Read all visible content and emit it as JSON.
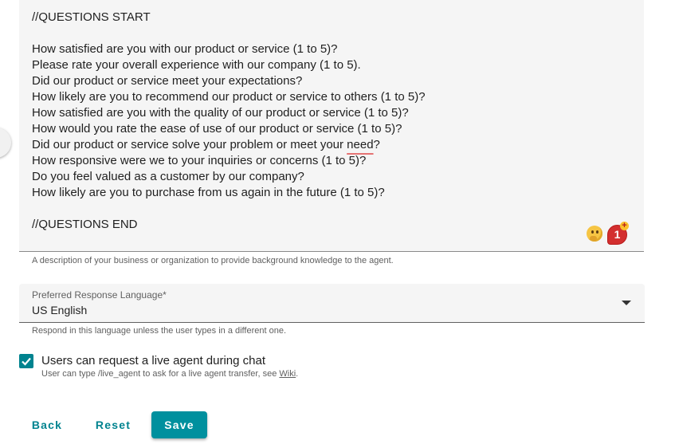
{
  "description_field": {
    "lines": [
      "//QUESTIONS START",
      "",
      "How satisfied are you with our product or service (1 to 5)?",
      "Please rate your overall experience with our company (1 to 5).",
      "Did our product or service meet your expectations?",
      "How likely are you to recommend our product or service to others (1 to 5)?",
      "How satisfied are you with the quality of our product or service (1 to 5)?",
      "How would you rate the ease of use of our product or service (1 to 5)?",
      "Did our product or service solve your problem or meet your ",
      "How responsive were we to your inquiries or concerns (1 to 5)?",
      "Do you feel valued as a customer by our company?",
      "How likely are you to purchase from us again in the future (1 to 5)?",
      "",
      "//QUESTIONS END"
    ],
    "misspelled_word": "need",
    "line9_suffix": "?",
    "badge_count": "1",
    "badge_plus": "+",
    "helper_text": "A description of your business or organization to provide background knowledge to the agent."
  },
  "language_select": {
    "label": "Preferred Response Language",
    "required_mark": "*",
    "value": "US English",
    "helper_text": "Respond in this language unless the user types in a different one."
  },
  "live_agent": {
    "checked": true,
    "label": "Users can request a live agent during chat",
    "help_prefix": "User can type /live_agent to ask for a live agent transfer, see ",
    "help_link": "Wiki",
    "help_suffix": "."
  },
  "actions": {
    "back_label": "Back",
    "reset_label": "Reset",
    "save_label": "Save"
  },
  "colors": {
    "accent": "#00838f",
    "save_bg": "#00909e",
    "field_bg": "#f5f5f5"
  }
}
